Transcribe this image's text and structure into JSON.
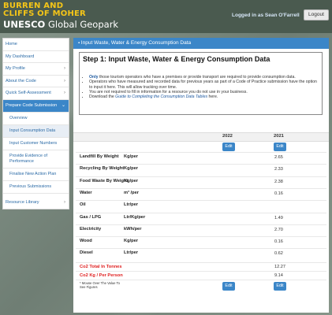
{
  "header": {
    "logo_line1": "BURREN AND",
    "logo_line2": "CLIFFS OF MOHER",
    "logo_line3_a": "UNESCO",
    "logo_line3_b": " Global Geopark",
    "logged_in": "Logged in as Sean O'Farrell",
    "logout_label": "Logout"
  },
  "sidebar": {
    "items": [
      {
        "label": "Home"
      },
      {
        "label": "My Dashboard"
      },
      {
        "label": "My Profile"
      },
      {
        "label": "About the Code"
      },
      {
        "label": "Quick Self-Assessment"
      },
      {
        "label": "Prepare Code Submission"
      }
    ],
    "subitems": [
      {
        "label": "Overview"
      },
      {
        "label": "Input Consumption Data"
      },
      {
        "label": "Input Customer Numbers"
      },
      {
        "label": "Provide Evidence of Performance"
      },
      {
        "label": "Finalise New Action Plan"
      },
      {
        "label": "Previous Submissions"
      }
    ],
    "resource": "Resource Library"
  },
  "panel": {
    "heading": "Input Waste, Water & Energy Consumption Data",
    "step_title": "Step 1: Input Waste, Water & Energy Consumption Data",
    "bullet1_hl": "Only",
    "bullet1_rest": " those tourism operators who have a premises or provide transport are required to provide consumption data.",
    "bullet2": "Operators who have measured and recorded data for previous years as part of a Code of Practice submission have the option to input it here.  This will allow tracking over time.",
    "bullet3": "You are not required to fill in information for a resource you do not use in your business.",
    "bullet4_a": "Download the ",
    "bullet4_link": "Guide to Completing the Consumption Data Tables",
    "bullet4_b": " here."
  },
  "table": {
    "years": [
      "2022",
      "2021"
    ],
    "edit_label": "Edit",
    "rows": [
      {
        "label": "Landfill By Weight",
        "unit": "Kg/per",
        "value": "2.65"
      },
      {
        "label": "Recycling By Weight",
        "unit": "Kg/per",
        "value": "2.33"
      },
      {
        "label": "Food Waste By Weight",
        "unit": "Kg/per",
        "value": "2.38"
      },
      {
        "label": "Water",
        "unit": "m³ /per",
        "value": "0.16"
      },
      {
        "label": "Oil",
        "unit": "Ltr/per",
        "value": ""
      },
      {
        "label": "Gas / LPG",
        "unit": "Ltr/Kg/per",
        "value": "1.49"
      },
      {
        "label": "Electricity",
        "unit": "kWh/per",
        "value": "2.70"
      },
      {
        "label": "Wood",
        "unit": "Kg/per",
        "value": "0.16"
      },
      {
        "label": "Diesel",
        "unit": "Ltr/per",
        "value": "0.62"
      }
    ],
    "co2_total_label": "Co2 Total In Tonnes",
    "co2_total_value": "12.27",
    "co2_person_label": "Co2 Kg / Per Person",
    "co2_person_value": "9.14",
    "note": "* Mouse Over The Value To See Figures"
  },
  "colors": {
    "accent": "#3b86c8",
    "logo_yellow": "#f4c518",
    "alert_red": "#e02020"
  }
}
